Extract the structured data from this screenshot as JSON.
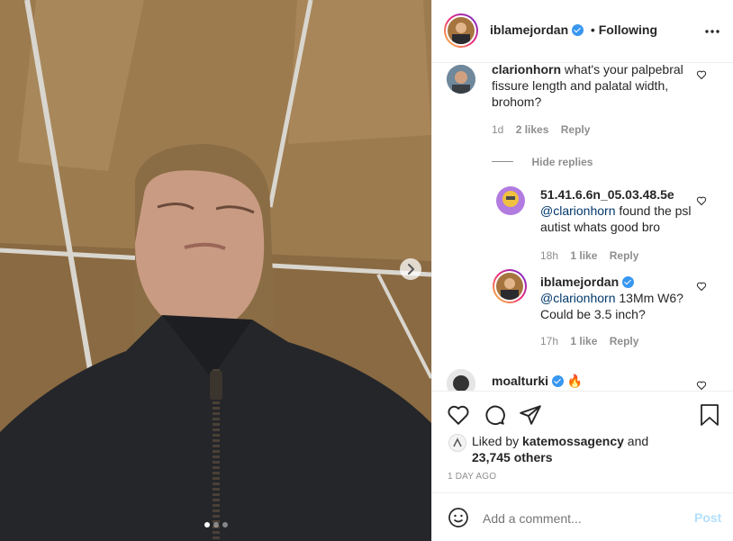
{
  "post": {
    "username": "iblamejordan",
    "follow_status": "Following",
    "bullet": "•",
    "more_icon": "more-horizontal-icon"
  },
  "media": {
    "carousel_dots": 3,
    "active_dot": 0
  },
  "comments": [
    {
      "username": "clarionhorn",
      "text": "what's your palpebral fissure length and palatal width, brohom?",
      "time": "1d",
      "likes": "2 likes",
      "reply": "Reply",
      "hide_replies": "Hide replies",
      "replies": [
        {
          "username": "51.41.6.6n_05.03.48.5e",
          "mention": "@clarionhorn",
          "text": " found the psl autist whats good bro",
          "time": "18h",
          "likes": "1 like",
          "reply": "Reply"
        },
        {
          "username": "iblamejordan",
          "verified": true,
          "mention": "@clarionhorn",
          "text": " 13Mm W6? Could be 3.5 inch?",
          "time": "17h",
          "likes": "1 like",
          "reply": "Reply"
        }
      ]
    },
    {
      "username": "moalturki",
      "verified": true,
      "emoji": "🔥"
    }
  ],
  "likes": {
    "prefix": "Liked by ",
    "liked_by": "katemossagency",
    "and": " and",
    "others": "23,745 others"
  },
  "timestamp": "1 DAY AGO",
  "add_comment": {
    "placeholder": "Add a comment...",
    "post_label": "Post"
  },
  "colors": {
    "verified": "#3897f0",
    "link_blue": "#00376b",
    "post_button": "#b2dffc",
    "muted": "#8e8e8e"
  }
}
